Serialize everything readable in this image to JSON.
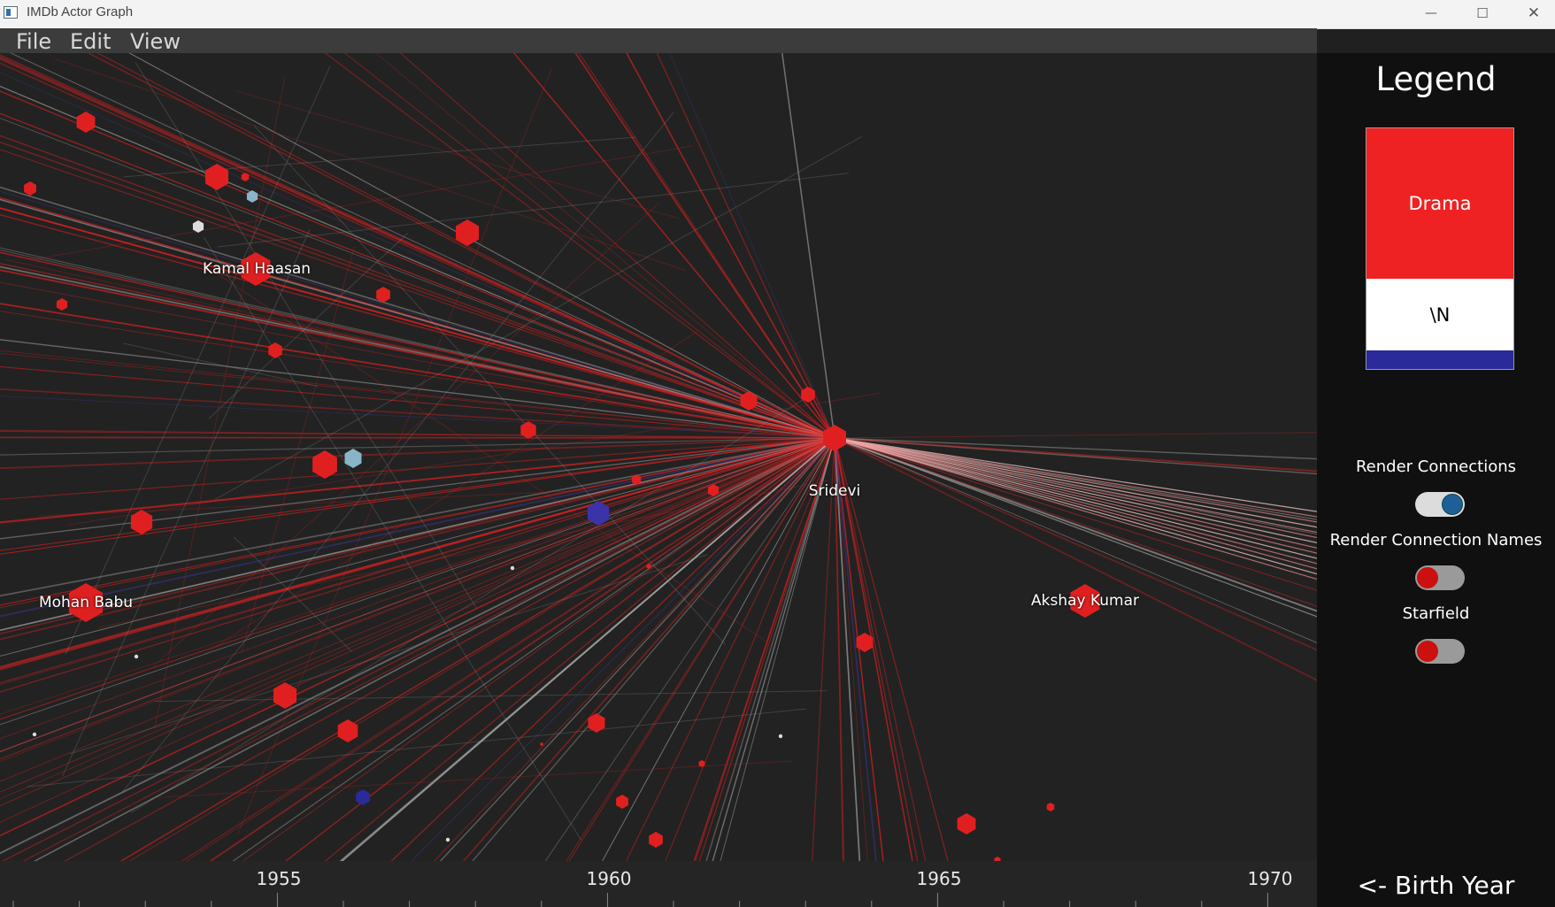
{
  "window": {
    "title": "IMDb Actor Graph",
    "minimize_glyph": "—",
    "maximize_glyph": "☐",
    "close_glyph": "✕"
  },
  "menu": {
    "items": [
      "File",
      "Edit",
      "View"
    ]
  },
  "graph": {
    "center_label": "Sridevi",
    "labels": {
      "kamal": "Kamal Haasan",
      "mohan": "Mohan Babu",
      "akshay": "Akshay Kumar"
    },
    "colors": {
      "background": "#222222",
      "drama": "#e02020",
      "unknown": "#ffffff",
      "other": "#2a2a9a",
      "light_blue": "#8ab4c8"
    }
  },
  "axis": {
    "title": "<- Birth Year",
    "ticks": [
      "1955",
      "1960",
      "1965",
      "1970"
    ]
  },
  "legend": {
    "title": "Legend",
    "entries": [
      {
        "label": "Drama",
        "color": "#ee2222"
      },
      {
        "label": "\\N",
        "color": "#ffffff"
      },
      {
        "label": "",
        "color": "#2a2a9a"
      }
    ]
  },
  "controls": {
    "render_connections": {
      "label": "Render Connections",
      "state": "on"
    },
    "render_connection_names": {
      "label": "Render Connection Names",
      "state": "off"
    },
    "starfield": {
      "label": "Starfield",
      "state": "off"
    }
  }
}
